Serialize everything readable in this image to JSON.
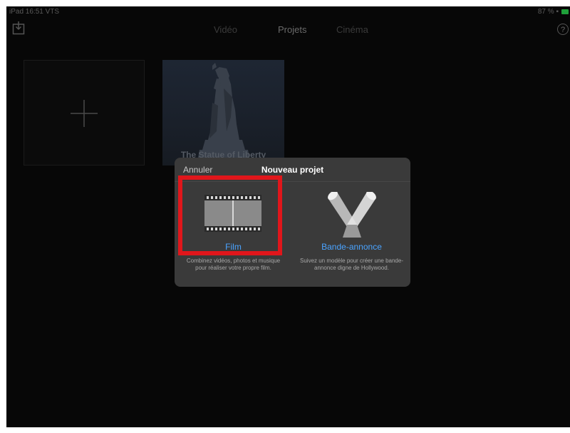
{
  "status_bar": {
    "left_text": "iPad 16:51 VTS",
    "right_text": "87 % ▪",
    "battery_color": "#1fa03a"
  },
  "nav": {
    "import_icon": "import-icon",
    "help_icon": "help-icon",
    "help_glyph": "?",
    "tabs": [
      {
        "label": "Vidéo",
        "selected": false
      },
      {
        "label": "Projets",
        "selected": true
      },
      {
        "label": "Cinéma",
        "selected": false
      }
    ]
  },
  "projects": {
    "new_tile_icon": "plus-icon",
    "items": [
      {
        "title": "The Statue of Liberty"
      }
    ]
  },
  "dialog": {
    "cancel_label": "Annuler",
    "title": "Nouveau projet",
    "options": [
      {
        "label": "Film",
        "icon": "film-icon",
        "description": "Combinez vidéos, photos et musique pour réaliser votre propre film."
      },
      {
        "label": "Bande-annonce",
        "icon": "trailer-spotlights-icon",
        "description": "Suivez un modèle pour créer une bande-annonce digne de Hollywood."
      }
    ],
    "accent_color": "#4aa3ff",
    "highlight_color": "#e0161b"
  }
}
